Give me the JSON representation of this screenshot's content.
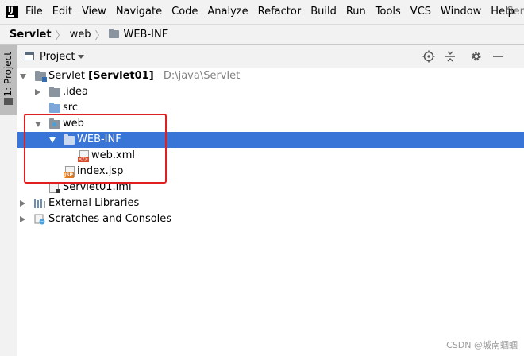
{
  "menubar": {
    "items": [
      "File",
      "Edit",
      "View",
      "Navigate",
      "Code",
      "Analyze",
      "Refactor",
      "Build",
      "Run",
      "Tools",
      "VCS",
      "Window",
      "Help"
    ],
    "underline": [
      "F",
      "E",
      "V",
      "N",
      "C",
      "z",
      "R",
      "B",
      "u",
      "T",
      "S",
      "W",
      "H"
    ],
    "right_truncated": "Ser"
  },
  "breadcrumb": {
    "project": "Servlet",
    "folder": "web",
    "current": "WEB-INF"
  },
  "stripe": {
    "tab_label": "1: Project"
  },
  "panel": {
    "title": "Project",
    "tools": [
      "target-icon",
      "collapse-all-icon",
      "gear-icon",
      "minimize-icon"
    ]
  },
  "tree": {
    "root_name": "Servlet",
    "root_module": "[Servlet01]",
    "root_path": "D:\\java\\Servlet",
    "idea": ".idea",
    "src": "src",
    "web": "web",
    "webinf": "WEB-INF",
    "webxml": "web.xml",
    "indexjsp": "index.jsp",
    "iml": "Servlet01.iml",
    "external": "External Libraries",
    "scratches": "Scratches and Consoles",
    "selected": "WEB-INF"
  },
  "annotation": {
    "color": "#e02020"
  },
  "colors": {
    "selection": "#3875d7",
    "chrome": "#f2f2f2"
  },
  "watermark": "CSDN @城南蝈蝈"
}
